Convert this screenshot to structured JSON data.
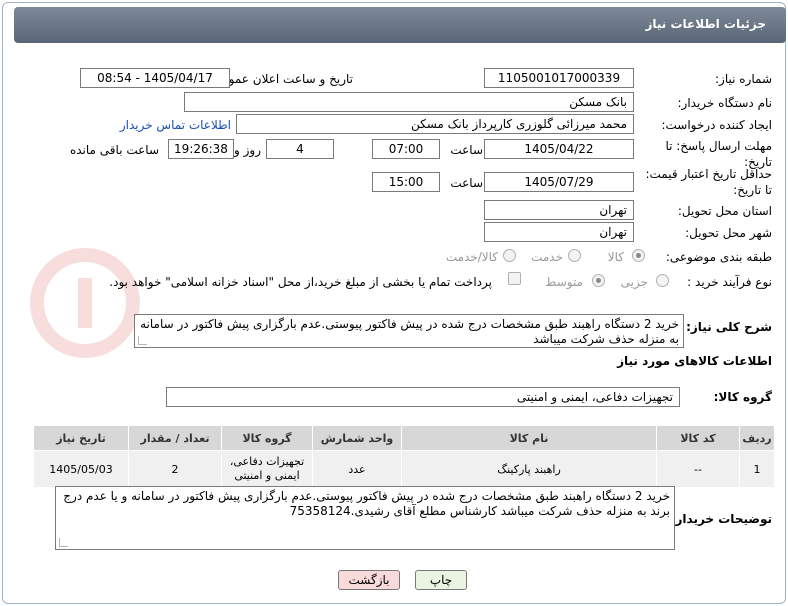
{
  "header": {
    "title": "جزئیات اطلاعات نیاز"
  },
  "fields": {
    "need_number_label": "شماره نیاز:",
    "need_number": "1105001017000339",
    "announce_label": "تاریخ و ساعت اعلان عمومی:",
    "announce_value": "1405/04/17 - 08:54",
    "buyer_org_label": "نام دستگاه خریدار:",
    "buyer_org": "بانک مسکن",
    "creator_label": "ایجاد کننده درخواست:",
    "creator": "محمد میرزائی گلوزری کارپرداز بانک مسکن",
    "contact_link": "اطلاعات تماس خریدار",
    "reply_deadline_label": "مهلت ارسال پاسخ: تا تاریخ:",
    "reply_date": "1405/04/22",
    "time_label": "ساعت",
    "reply_time": "07:00",
    "days": "4",
    "days_label": "روز و",
    "remaining_time": "19:26:38",
    "remaining_label": "ساعت باقی مانده",
    "validity_label": "حداقل تاریخ اعتبار قیمت: تا تاریخ:",
    "validity_date": "1405/07/29",
    "validity_time": "15:00",
    "province_label": "استان محل تحویل:",
    "province": "تهران",
    "city_label": "شهر محل تحویل:",
    "city": "تهران",
    "category_label": "طبقه بندی موضوعی:",
    "category_options": [
      "کالا",
      "خدمت",
      "کالا/خدمت"
    ],
    "category_selected": "کالا",
    "process_label": "نوع فرآیند خرید :",
    "process_options": [
      "جزیی",
      "متوسط"
    ],
    "process_selected": "جزیی",
    "payment_note": "پرداخت تمام یا بخشی از مبلغ خرید،از محل \"اسناد خزانه اسلامی\" خواهد بود."
  },
  "description": {
    "label": "شرح کلی نیاز:",
    "text": "خرید 2 دستگاه راهبند طبق مشخصات درج شده در پیش فاکتور پیوستی.عدم بارگزاری پیش فاکتور در سامانه به منزله حذف شرکت میباشد"
  },
  "goods": {
    "section_title": "اطلاعات کالاهای مورد نیاز",
    "group_label": "گروه کالا:",
    "group_value": "تجهیزات دفاعی، ایمنی و امنیتی",
    "columns": [
      "ردیف",
      "کد کالا",
      "نام کالا",
      "واحد شمارش",
      "گروه کالا",
      "تعداد / مقدار",
      "تاریخ نیاز"
    ],
    "rows": [
      {
        "row": "1",
        "code": "--",
        "name": "راهبند پارکینگ",
        "unit": "عدد",
        "group": "تجهیزات دفاعی، ایمنی و امنیتی",
        "qty": "2",
        "date": "1405/05/03"
      }
    ]
  },
  "buyer_notes": {
    "label": "توضیحات خریدار:",
    "text": "خرید 2 دستگاه راهبند طبق مشخصات درج شده در پیش فاکتور پیوستی.عدم بارگزاری پیش فاکتور در سامانه و یا عدم درج برند به منزله حذف شرکت میباشد کارشناس مطلع آقای رشیدی.75358124"
  },
  "buttons": {
    "print": "چاپ",
    "back": "بازگشت"
  },
  "colors": {
    "header": "#6b7786",
    "link": "#1a4fb3",
    "back_button": "#f8dada",
    "print_button": "#e9f5e0"
  }
}
